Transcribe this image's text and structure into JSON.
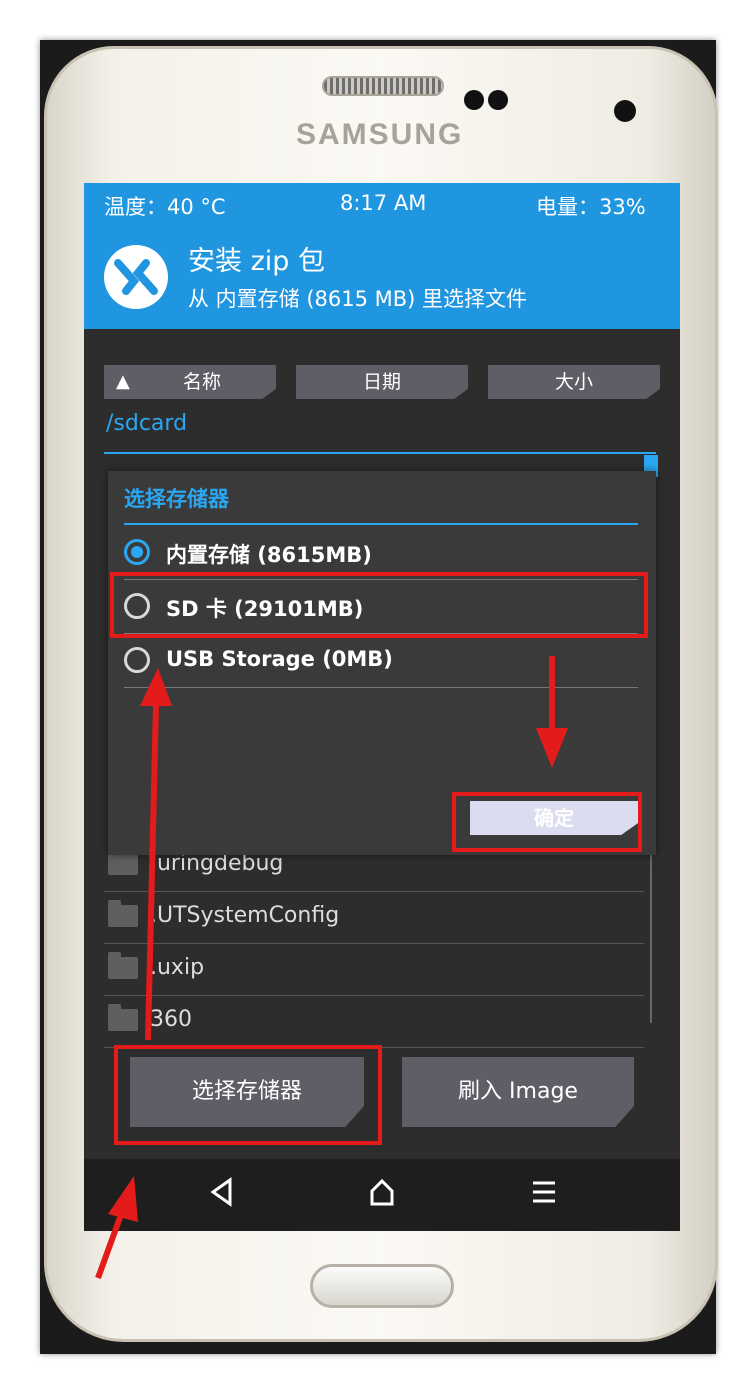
{
  "status_bar": {
    "temp": "温度：40 °C",
    "time": "8:17 AM",
    "battery": "电量：33%"
  },
  "header": {
    "title": "安装 zip 包",
    "subtitle": "从 内置存储 (8615 MB) 里选择文件"
  },
  "sort_buttons": [
    {
      "label": "名称",
      "icon": "triangle-up-icon"
    },
    {
      "label": "日期"
    },
    {
      "label": "大小"
    }
  ],
  "current_path": "/sdcard",
  "files": [
    ".uringdebug",
    ".UTSystemConfig",
    ".uxip",
    "360"
  ],
  "dialog": {
    "title": "选择存储器",
    "options": [
      {
        "label": "内置存储 (8615MB)",
        "selected": true
      },
      {
        "label": "SD 卡 (29101MB)",
        "selected": false
      },
      {
        "label": "USB Storage (0MB)",
        "selected": false
      }
    ],
    "ok_label": "确定"
  },
  "bottom_buttons": {
    "select_storage": "选择存储器",
    "flash_image": "刷入 Image"
  },
  "nav_icons": [
    "back-icon",
    "home-icon",
    "menu-icon"
  ],
  "device_brand": "SAMSUNG",
  "colors": {
    "accent": "#2196e0",
    "annotation": "#e31b1b",
    "screen_bg": "#2d2d2d"
  }
}
